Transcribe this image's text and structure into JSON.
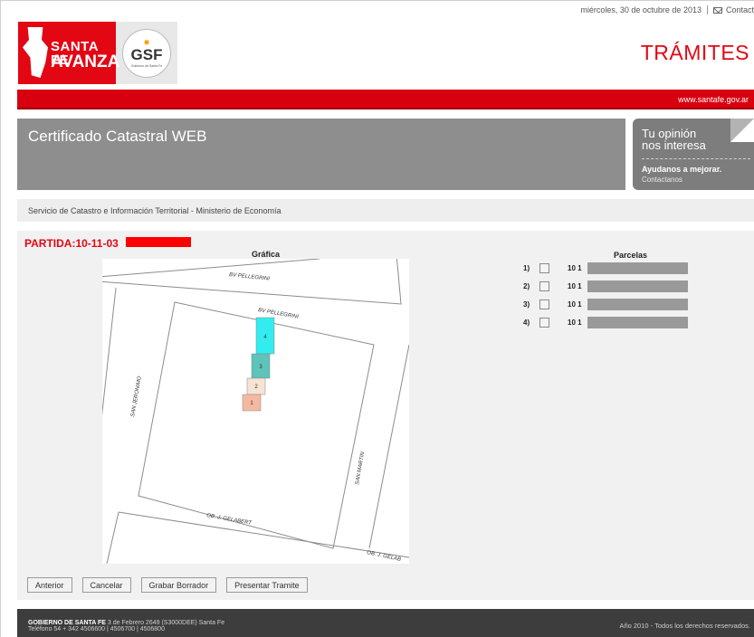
{
  "topbar": {
    "date": "miércoles, 30 de octubre de 2013",
    "contact_label": "Contact"
  },
  "logo": {
    "line1": "SANTA FE",
    "line2": "AVANZA",
    "gsf": "GSF",
    "gsf_sub": "Gobierno de Santa Fe"
  },
  "header": {
    "tramites": "TRÁMITES",
    "url": "www.santafe.gov.ar",
    "title": "Certificado Catastral WEB"
  },
  "opinion": {
    "line1": "Tu opinión",
    "line2": "nos interesa",
    "cta": "Ayudanos a mejorar.",
    "link": "Contactanos"
  },
  "ministry": "Servicio de Catastro e Información Territorial - Ministerio de Economía",
  "partida": "PARTIDA:10-11-03",
  "grafica_label": "Gráfica",
  "map": {
    "streets": [
      "BV PELLEGRINI",
      "BV PELLEGRINI",
      "SAN JERONIMO",
      "SAN MARTIN",
      "OB. J. GELABERT",
      "OB. J. GELAB"
    ],
    "lots": [
      "4",
      "3",
      "2",
      "1"
    ],
    "colors": {
      "lot4": "#33ecef",
      "lot3": "#5ec3b8",
      "lot2": "#f7e2d6",
      "lot1": "#f4b9a1"
    }
  },
  "parcelas": {
    "label": "Parcelas",
    "rows": [
      {
        "num": "1)",
        "code": "10 1"
      },
      {
        "num": "2)",
        "code": "10 1"
      },
      {
        "num": "3)",
        "code": "10 1"
      },
      {
        "num": "4)",
        "code": "10 1"
      }
    ]
  },
  "buttons": {
    "anterior": "Anterior",
    "cancelar": "Cancelar",
    "grabar": "Grabar Borrador",
    "presentar": "Presentar Tramite"
  },
  "footer": {
    "org": "GOBIERNO DE SANTA FE",
    "address": " 3 de Febrero 2649 (S3000DEE) Santa Fe",
    "phone": "Teléfono 54 + 342 4506600 | 4506700 | 4506800",
    "rights": "Año 2010 - Todos los derechos reservados."
  },
  "colors": {
    "brand_red": "#e30613",
    "title_gray": "#8e8e8e"
  }
}
